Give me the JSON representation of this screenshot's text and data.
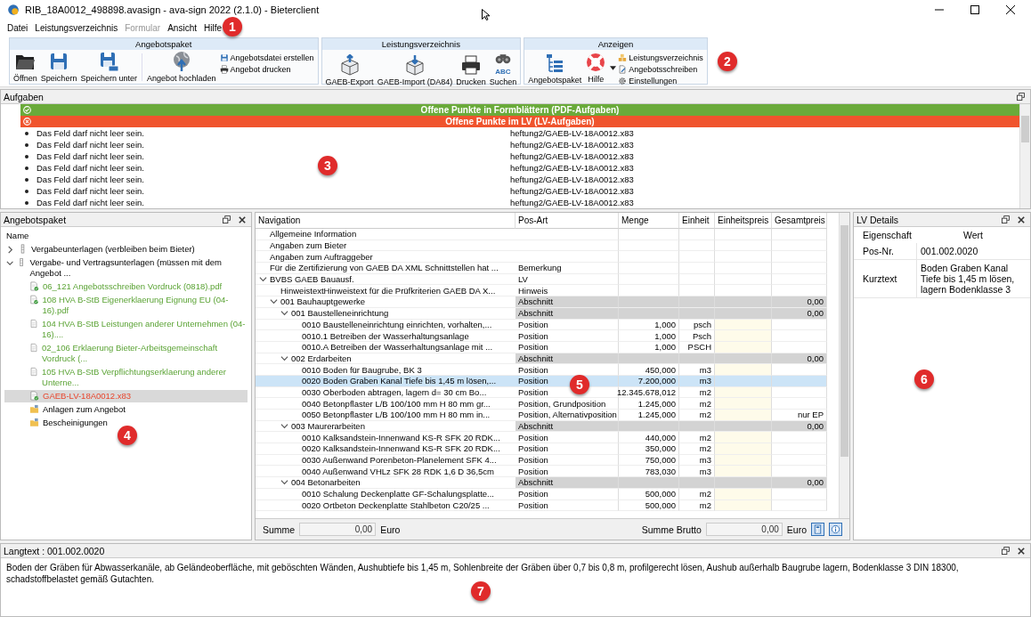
{
  "window": {
    "title": "RIB_18A0012_498898.avasign - ava-sign 2022 (2.1.0) - Bieterclient"
  },
  "menu": [
    {
      "label": "Datei",
      "disabled": false
    },
    {
      "label": "Leistungsverzeichnis",
      "disabled": false
    },
    {
      "label": "Formular",
      "disabled": true
    },
    {
      "label": "Ansicht",
      "disabled": false
    },
    {
      "label": "Hilfe",
      "disabled": false
    }
  ],
  "ribbon": [
    {
      "title": "Angebotspaket",
      "items": [
        {
          "kind": "large",
          "label": "Öffnen"
        },
        {
          "kind": "large",
          "label": "Speichern"
        },
        {
          "kind": "large",
          "label": "Speichern unter"
        },
        {
          "kind": "large",
          "label": "Angebot hochladen"
        },
        {
          "kind": "stack",
          "items": [
            "Angebotsdatei erstellen",
            "Angebot drucken"
          ]
        }
      ]
    },
    {
      "title": "Leistungsverzeichnis",
      "items": [
        {
          "kind": "large",
          "label": "GAEB-Export"
        },
        {
          "kind": "large",
          "label": "GAEB-Import (DA84)"
        },
        {
          "kind": "large",
          "label": "Drucken"
        },
        {
          "kind": "large",
          "label": "Suchen",
          "icon_text": "ABC"
        }
      ]
    },
    {
      "title": "Anzeigen",
      "items": [
        {
          "kind": "large",
          "label": "Angebotspaket"
        },
        {
          "kind": "dropdown",
          "label": "Hilfe"
        },
        {
          "kind": "stack",
          "items": [
            "Leistungsverzeichnis",
            "Angebotsschreiben",
            "Einstellungen"
          ]
        }
      ]
    }
  ],
  "tasks": {
    "title": "Aufgaben",
    "banners": [
      {
        "kind": "ok",
        "label": "Offene Punkte in Formblättern (PDF-Aufgaben)"
      },
      {
        "kind": "error",
        "label": "Offene Punkte im LV (LV-Aufgaben)"
      }
    ],
    "rows": [
      {
        "message": "Das Feld darf nicht leer sein.",
        "file": "heftung2/GAEB-LV-18A0012.x83"
      },
      {
        "message": "Das Feld darf nicht leer sein.",
        "file": "heftung2/GAEB-LV-18A0012.x83"
      },
      {
        "message": "Das Feld darf nicht leer sein.",
        "file": "heftung2/GAEB-LV-18A0012.x83"
      },
      {
        "message": "Das Feld darf nicht leer sein.",
        "file": "heftung2/GAEB-LV-18A0012.x83"
      },
      {
        "message": "Das Feld darf nicht leer sein.",
        "file": "heftung2/GAEB-LV-18A0012.x83"
      },
      {
        "message": "Das Feld darf nicht leer sein.",
        "file": "heftung2/GAEB-LV-18A0012.x83"
      },
      {
        "message": "Das Feld darf nicht leer sein.",
        "file": "heftung2/GAEB-LV-18A0012.x83"
      }
    ]
  },
  "package": {
    "title": "Angebotspaket",
    "header": "Name",
    "items": [
      {
        "kind": "archive",
        "label": "Vergabeunterlagen (verbleiben beim Bieter)",
        "complete": false,
        "invalid": false,
        "selected": false,
        "expanded": false
      },
      {
        "kind": "archive",
        "label": "Vergabe- und Vertragsunterlagen (müssen mit dem Angebot ...",
        "complete": false,
        "invalid": false,
        "selected": false,
        "expanded": true,
        "children": [
          {
            "kind": "signed",
            "label": "06_121 Angebotsschreiben Vordruck (0818).pdf",
            "complete": true,
            "invalid": false,
            "selected": false
          },
          {
            "kind": "signed",
            "label": "108 HVA B-StB Eigenerklaerung Eignung EU (04-16).pdf",
            "complete": true,
            "invalid": false,
            "selected": false
          },
          {
            "kind": "document",
            "label": "104 HVA B-StB Leistungen anderer Unternehmen (04-16)....",
            "complete": true,
            "invalid": false,
            "selected": false
          },
          {
            "kind": "document",
            "label": "02_106 Erklaerung Bieter-Arbeitsgemeinschaft Vordruck (...",
            "complete": true,
            "invalid": false,
            "selected": false
          },
          {
            "kind": "document",
            "label": "105 HVA B-StB Verpflichtungserklaerung anderer Unterne...",
            "complete": true,
            "invalid": false,
            "selected": false
          },
          {
            "kind": "signed",
            "label": "GAEB-LV-18A0012.x83",
            "invalid": true,
            "selected": true
          },
          {
            "kind": "folder",
            "label": "Anlagen zum Angebot",
            "complete": false,
            "invalid": false,
            "selected": false
          },
          {
            "kind": "folder",
            "label": "Bescheinigungen",
            "complete": false,
            "invalid": false,
            "selected": false
          }
        ]
      }
    ]
  },
  "lv": {
    "columns": [
      "Navigation",
      "Pos-Art",
      "Menge",
      "Einheit",
      "Einheitspreis",
      "Gesamtpreis"
    ],
    "rows": [
      {
        "kind": "info",
        "label": "Allgemeine Information",
        "selected": false
      },
      {
        "kind": "info",
        "label": "Angaben zum Bieter",
        "selected": false
      },
      {
        "kind": "info",
        "label": "Angaben zum Auftraggeber",
        "selected": false
      },
      {
        "kind": "info",
        "label": "Für die Zertifizierung von GAEB DA XML Schnittstellen hat ...",
        "pos_art": "Bemerkung",
        "selected": false
      },
      {
        "kind": "info",
        "label": "BVBS GAEB Bauausf.",
        "pos_art": "LV",
        "selected": false,
        "expanded": true,
        "children": [
          {
            "kind": "info",
            "label": "HinweistextHinweistext für die Prüfkriterien GAEB DA X...",
            "pos_art": "Hinweis",
            "selected": false
          },
          {
            "kind": "section",
            "label": "001 Bauhauptgewerke",
            "pos_art": "Abschnitt",
            "gesamtpreis": "0,00",
            "selected": false,
            "expanded": true,
            "children": [
              {
                "kind": "section",
                "label": "001 Baustelleneinrichtung",
                "pos_art": "Abschnitt",
                "gesamtpreis": "0,00",
                "selected": false,
                "expanded": true,
                "children": [
                  {
                    "kind": "position",
                    "label": "0010 Baustelleneinrichtung einrichten, vorhalten,...",
                    "pos_art": "Position",
                    "menge": "1,000",
                    "einheit": "psch",
                    "selected": false
                  },
                  {
                    "kind": "position",
                    "label": "0010.1 Betreiben der Wasserhaltungsanlage",
                    "pos_art": "Position",
                    "menge": "1,000",
                    "einheit": "Psch",
                    "selected": false
                  },
                  {
                    "kind": "position",
                    "label": "0010.A Betreiben der Wasserhaltungsanlage mit ...",
                    "pos_art": "Position",
                    "menge": "1,000",
                    "einheit": "PSCH",
                    "selected": false
                  }
                ]
              },
              {
                "kind": "section",
                "label": "002 Erdarbeiten",
                "pos_art": "Abschnitt",
                "gesamtpreis": "0,00",
                "selected": false,
                "expanded": true,
                "children": [
                  {
                    "kind": "position",
                    "label": "0010 Boden für Baugrube, BK 3",
                    "pos_art": "Position",
                    "menge": "450,000",
                    "einheit": "m3",
                    "selected": false
                  },
                  {
                    "kind": "position",
                    "label": "0020 Boden Graben Kanal Tiefe bis 1,45 m lösen,...",
                    "pos_art": "Position",
                    "menge": "7.200,000",
                    "einheit": "m3",
                    "selected": true
                  },
                  {
                    "kind": "position",
                    "label": "0030 Oberboden abtragen, lagern d= 30 cm Bo...",
                    "pos_art": "Position",
                    "menge": "12.345.678,012",
                    "einheit": "m2",
                    "selected": false
                  },
                  {
                    "kind": "position",
                    "label": "0040 Betonpflaster L/B 100/100 mm H 80 mm gr...",
                    "pos_art": "Position, Grundposition",
                    "menge": "1.245,000",
                    "einheit": "m2",
                    "selected": false
                  },
                  {
                    "kind": "position",
                    "label": "0050 Betonpflaster L/B 100/100 mm H 80 mm in...",
                    "pos_art": "Position, Alternativposition",
                    "menge": "1.245,000",
                    "einheit": "m2",
                    "gesamtpreis": "nur EP",
                    "selected": false
                  }
                ]
              },
              {
                "kind": "section",
                "label": "003 Maurerarbeiten",
                "pos_art": "Abschnitt",
                "gesamtpreis": "0,00",
                "selected": false,
                "expanded": true,
                "children": [
                  {
                    "kind": "position",
                    "label": "0010 Kalksandstein-Innenwand KS-R SFK 20 RDK...",
                    "pos_art": "Position",
                    "menge": "440,000",
                    "einheit": "m2",
                    "selected": false
                  },
                  {
                    "kind": "position",
                    "label": "0020 Kalksandstein-Innenwand KS-R SFK 20 RDK...",
                    "pos_art": "Position",
                    "menge": "350,000",
                    "einheit": "m2",
                    "selected": false
                  },
                  {
                    "kind": "position",
                    "label": "0030 Außenwand Porenbeton-Planelement SFK 4...",
                    "pos_art": "Position",
                    "menge": "750,000",
                    "einheit": "m3",
                    "selected": false
                  },
                  {
                    "kind": "position",
                    "label": "0040 Außenwand VHLz SFK 28 RDK 1,6 D 36,5cm",
                    "pos_art": "Position",
                    "menge": "783,030",
                    "einheit": "m3",
                    "selected": false
                  }
                ]
              },
              {
                "kind": "section",
                "label": "004 Betonarbeiten",
                "pos_art": "Abschnitt",
                "gesamtpreis": "0,00",
                "selected": false,
                "expanded": true,
                "children": [
                  {
                    "kind": "position",
                    "label": "0010 Schalung Deckenplatte GF-Schalungsplatte...",
                    "pos_art": "Position",
                    "menge": "500,000",
                    "einheit": "m2",
                    "selected": false
                  },
                  {
                    "kind": "position",
                    "label": "0020 Ortbeton Deckenplatte Stahlbeton C20/25 ...",
                    "pos_art": "Position",
                    "menge": "500,000",
                    "einheit": "m2",
                    "selected": false
                  }
                ]
              }
            ]
          }
        ]
      }
    ],
    "totals": [
      {
        "label": "Summe",
        "value": "0,00",
        "unit": "Euro"
      },
      {
        "label": "Summe Brutto",
        "value": "0,00",
        "unit": "Euro"
      }
    ]
  },
  "details": {
    "title": "LV Details",
    "columns": [
      "Eigenschaft",
      "Wert"
    ],
    "rows": [
      {
        "property": "Pos-Nr.",
        "value": "001.002.0020"
      },
      {
        "property": "Kurztext",
        "value": "Boden Graben Kanal Tiefe bis 1,45 m lösen, lagern Bodenklasse 3"
      }
    ]
  },
  "longtext": {
    "title": "Langtext : 001.002.0020",
    "text": "Boden der Gräben für Abwasserkanäle, ab Geländeoberfläche, mit geböschten Wänden, Aushubtiefe bis 1,45 m, Sohlenbreite der Gräben über 0,7 bis 0,8 m, profilgerecht lösen, Aushub außerhalb Baugrube lagern, Bodenklasse 3 DIN 18300, schadstoffbelastet gemäß Gutachten."
  },
  "callouts": [
    "1",
    "2",
    "3",
    "4",
    "5",
    "6",
    "7"
  ]
}
